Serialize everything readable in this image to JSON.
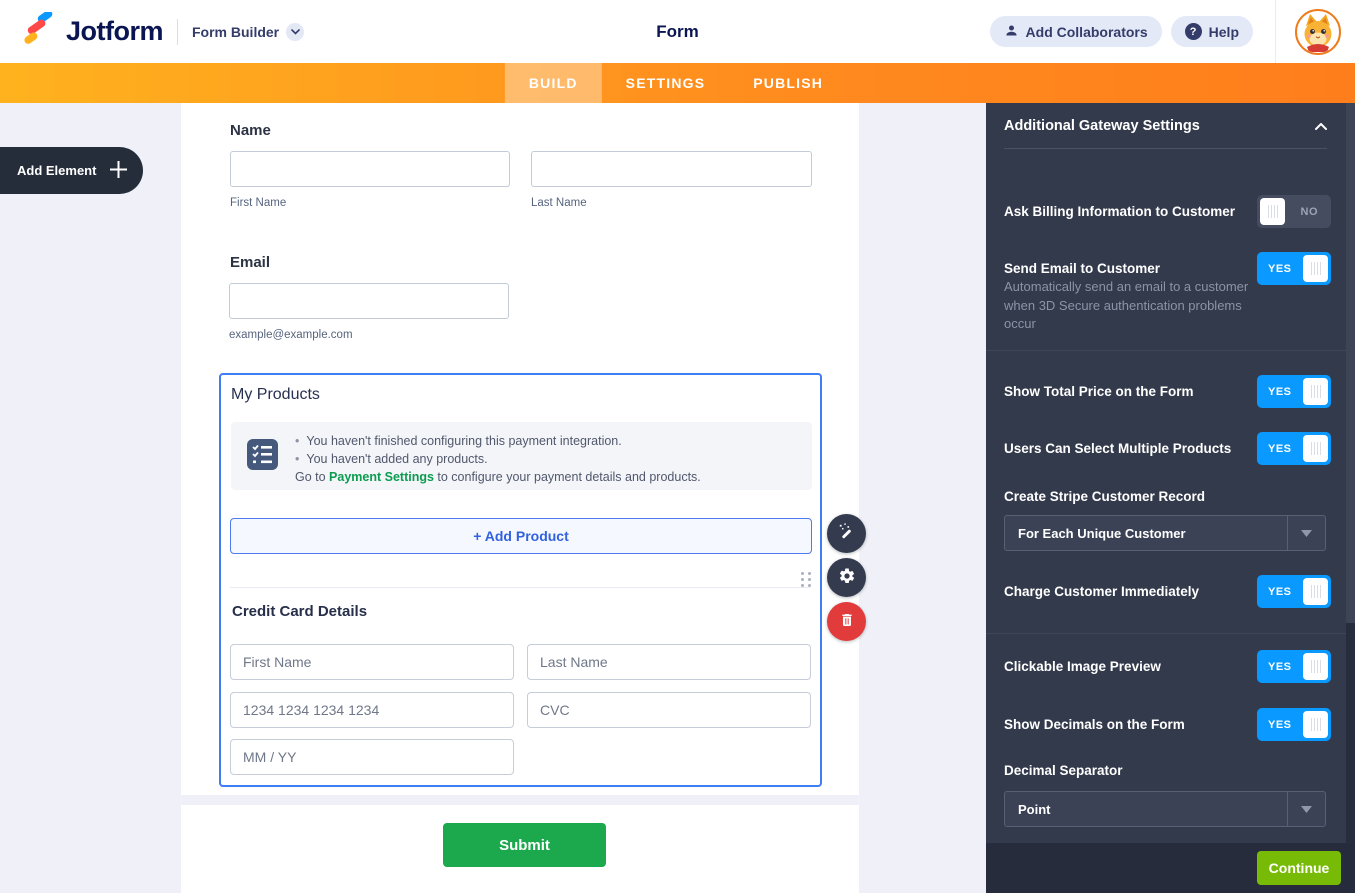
{
  "header": {
    "logo_text": "Jotform",
    "builder_label": "Form Builder",
    "title": "Form",
    "add_collaborators": "Add Collaborators",
    "help": "Help"
  },
  "tabs": [
    {
      "label": "BUILD",
      "active": true
    },
    {
      "label": "SETTINGS",
      "active": false
    },
    {
      "label": "PUBLISH",
      "active": false
    }
  ],
  "add_element_label": "Add Element",
  "form": {
    "name": {
      "label": "Name",
      "first_sublabel": "First Name",
      "last_sublabel": "Last Name"
    },
    "email": {
      "label": "Email",
      "sublabel": "example@example.com"
    },
    "products": {
      "title": "My Products",
      "warnings": [
        "You haven't finished configuring this payment integration.",
        "You haven't added any products."
      ],
      "goto_prefix": "Go to ",
      "goto_link": "Payment Settings",
      "goto_suffix": " to configure your payment details and products.",
      "add_product_label": "+ Add Product"
    },
    "credit_card": {
      "title": "Credit Card Details",
      "first_placeholder": "First Name",
      "last_placeholder": "Last Name",
      "number_placeholder": "1234 1234 1234 1234",
      "cvc_placeholder": "CVC",
      "expiry_placeholder": "MM / YY"
    },
    "submit_label": "Submit"
  },
  "sidebar": {
    "title": "Additional Gateway Settings",
    "rows": [
      {
        "label": "Ask Billing Information to Customer",
        "value": "NO"
      },
      {
        "label": "Send Email to Customer",
        "value": "YES",
        "description": "Automatically send an email to a customer when 3D Secure authentication problems occur"
      },
      {
        "label": "Show Total Price on the Form",
        "value": "YES"
      },
      {
        "label": "Users Can Select Multiple Products",
        "value": "YES"
      },
      {
        "label": "Create Stripe Customer Record",
        "value": "For Each Unique Customer"
      },
      {
        "label": "Charge Customer Immediately",
        "value": "YES"
      },
      {
        "label": "Clickable Image Preview",
        "value": "YES"
      },
      {
        "label": "Show Decimals on the Form",
        "value": "YES"
      },
      {
        "label": "Decimal Separator",
        "value": "Point"
      }
    ],
    "continue_label": "Continue"
  },
  "colors": {
    "brand_navy": "#0A1551",
    "orange_bar_start": "#FFB21E",
    "orange_bar_end": "#FF7E1C",
    "toggle_on_blue": "#0A99FF",
    "sidebar_bg": "#333A4B",
    "selection_blue": "#3F7DF2",
    "payment_link_green": "#0B9C4F",
    "submit_green": "#1CA94E",
    "continue_green": "#78BB07",
    "delete_red": "#E23B3B"
  }
}
